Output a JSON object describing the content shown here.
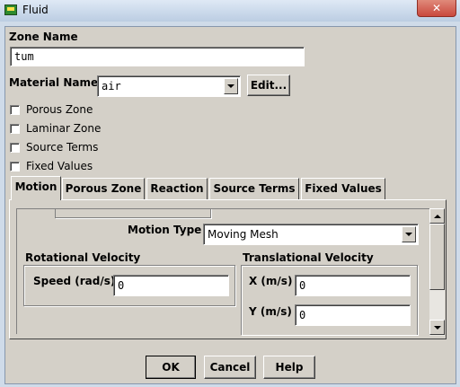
{
  "window": {
    "title": "Fluid",
    "close_glyph": "✕"
  },
  "zone_name": {
    "label": "Zone Name",
    "value": "tum"
  },
  "material": {
    "label": "Material Name",
    "value": "air",
    "edit_label": "Edit..."
  },
  "checkboxes": [
    {
      "label": "Porous Zone",
      "checked": false
    },
    {
      "label": "Laminar Zone",
      "checked": false
    },
    {
      "label": "Source Terms",
      "checked": false
    },
    {
      "label": "Fixed Values",
      "checked": false
    }
  ],
  "tabs": [
    "Motion",
    "Porous Zone",
    "Reaction",
    "Source Terms",
    "Fixed Values"
  ],
  "active_tab": "Motion",
  "motion": {
    "motion_type_label": "Motion Type",
    "motion_type_value": "Moving Mesh",
    "rotational": {
      "title": "Rotational Velocity",
      "speed_label": "Speed (rad/s)",
      "speed_value": "0"
    },
    "translational": {
      "title": "Translational Velocity",
      "x_label": "X (m/s)",
      "x_value": "0",
      "y_label": "Y (m/s)",
      "y_value": "0"
    }
  },
  "buttons": {
    "ok": "OK",
    "cancel": "Cancel",
    "help": "Help"
  },
  "colors": {
    "dialog_face": "#d4d0c8",
    "close_button": "#c9483d",
    "title_icon_green": "#2e8b2e"
  }
}
